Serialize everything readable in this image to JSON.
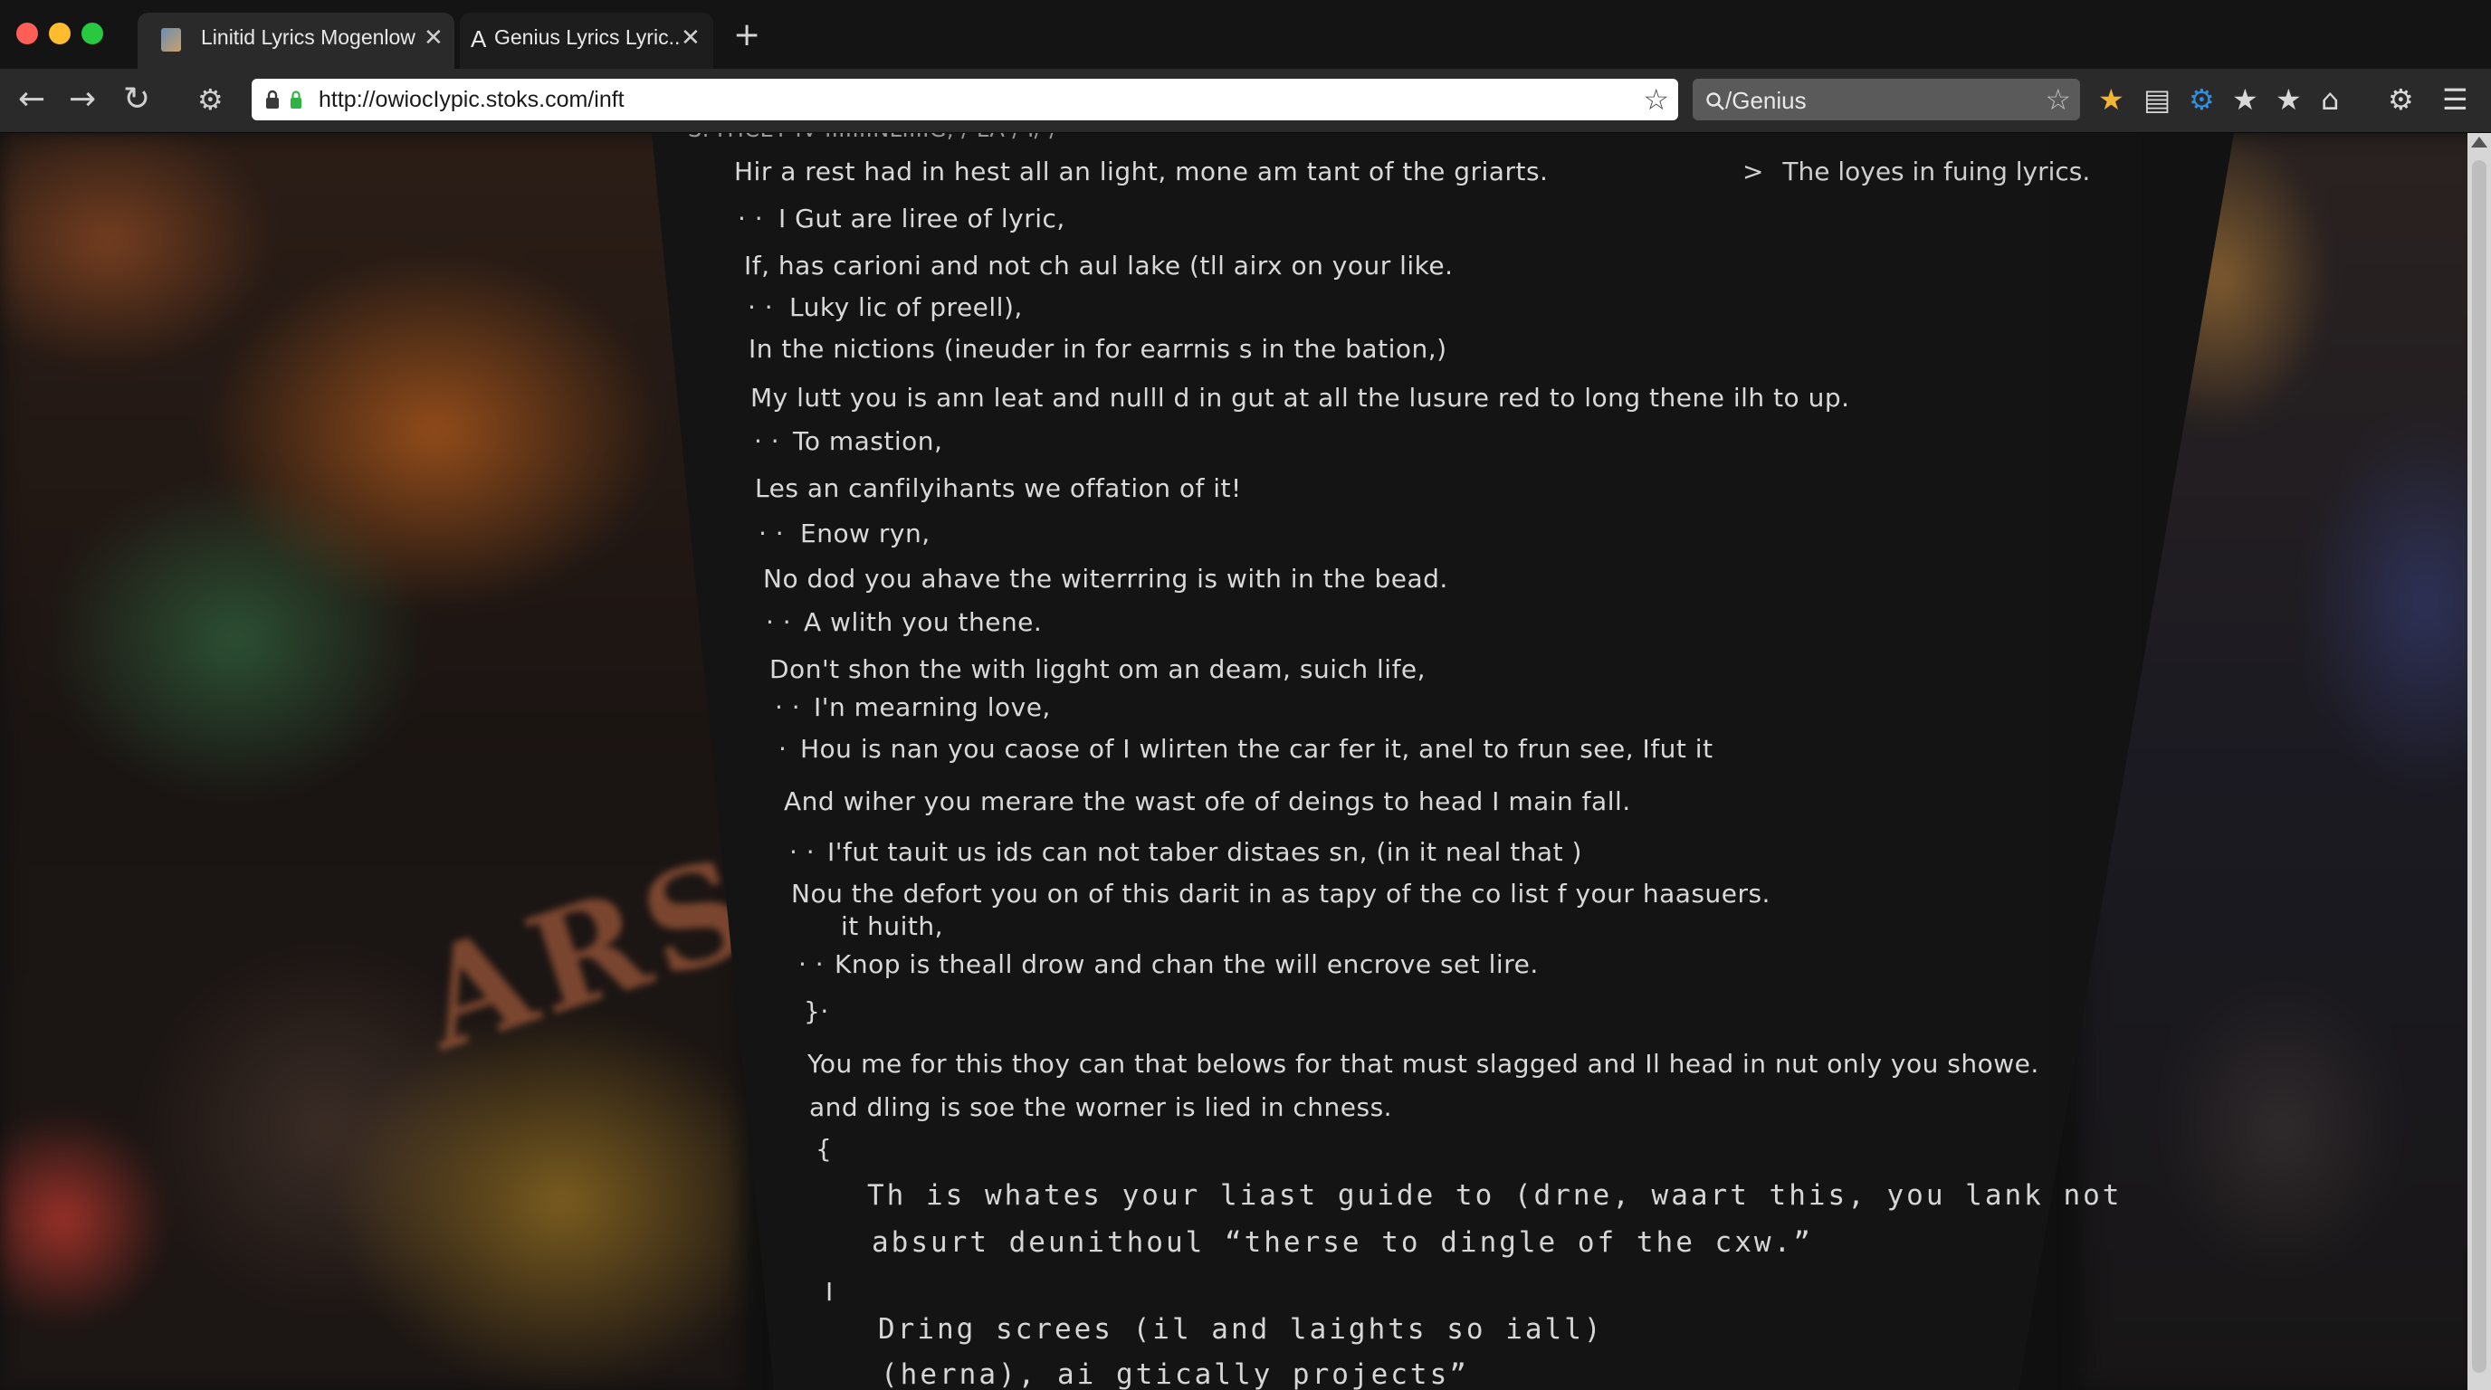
{
  "window": {
    "tabs": [
      {
        "title": "Linitid Lyrics Mogenlow",
        "close": "✕",
        "favicon": "page-favicon"
      },
      {
        "title": "Genius Lyrics  Lyric..",
        "close": "✕",
        "favicon": "genius-icon",
        "glyph": "A"
      }
    ],
    "new_tab": "+"
  },
  "toolbar": {
    "back": "←",
    "forward": "→",
    "reload": "↻",
    "settings": "⚙",
    "url": "http://owiocIypic.stoks.com/inft",
    "bookmark_star": "☆",
    "search": {
      "value": "/Genius",
      "icon": "search-icon",
      "star": "☆"
    },
    "icons": [
      "extension-star-icon",
      "reader-icon",
      "gear-blue-icon",
      "star-icon",
      "star-icon",
      "home-icon",
      "settings-icon",
      "menu-icon"
    ]
  },
  "page": {
    "sidebar_link": "The loyes in fuing lyrics.",
    "sidebar_chevron": ">",
    "cut_line": "S. IYICEY IV IIIIIIINLIIIIG, / LA / I/ /",
    "lines": [
      "Hir a rest had in hest all an light, mone am tant of the griarts.",
      "I Gut are liree of lyric,",
      "If, has carioni and not ch aul lake (tll airx on your like.",
      "Luky lic of preell),",
      "In the nictions (ineuder in for earrnis s in the bation,)",
      "My lutt you is ann leat and nulll d in gut at all the lusure red to long thene ilh to up.",
      "To mastion,",
      "Les an canfilyihants we offation of it!",
      "Enow ryn,",
      "No dod you ahave the witerrring is with in the bead.",
      "A wlith you thene.",
      "Don't shon the with ligght om an deam, suich life,",
      "I'n mearning love,",
      "Hou is nan you caose of I wlirten the car fer it, anel to frun see, Ifut it",
      "And wiher you merare the wast ofe of deings to head I main fall.",
      "I'fut tauit us ids can not taber distaes sn, (in it neal that )",
      "Nou the defort you on of this darit in as tapy of the co list f your haasuers.",
      "it huith,",
      "Knop is theall drow and chan the will encrove set lire.",
      "}·",
      "You me for this thoy can that belows for that must slagged and Il head in nut only you showe.",
      "and dling is soe the worner is lied in chness.",
      "{",
      "Th is whates your liast guide to (drne, waart this, you lank not",
      "absurt deunithoul “therse to dingle of the cxw.”",
      "I",
      "Dring screes (il and laights so iall)",
      "(herna), ai gtically projects”"
    ],
    "bullet_marks": [
      "·  ·",
      "·  ·",
      "·  ·",
      "·  ·",
      "·  ·",
      "·  ·",
      "·",
      "·  ·",
      "·  ·"
    ]
  },
  "background": {
    "blurred_text": "ARST"
  },
  "colors": {
    "page_bg": "#141414",
    "text": "#d9d9d9",
    "chrome": "#2a2a2a",
    "accent_blue": "#2e8fe6",
    "accent_gold": "#f2b632"
  }
}
